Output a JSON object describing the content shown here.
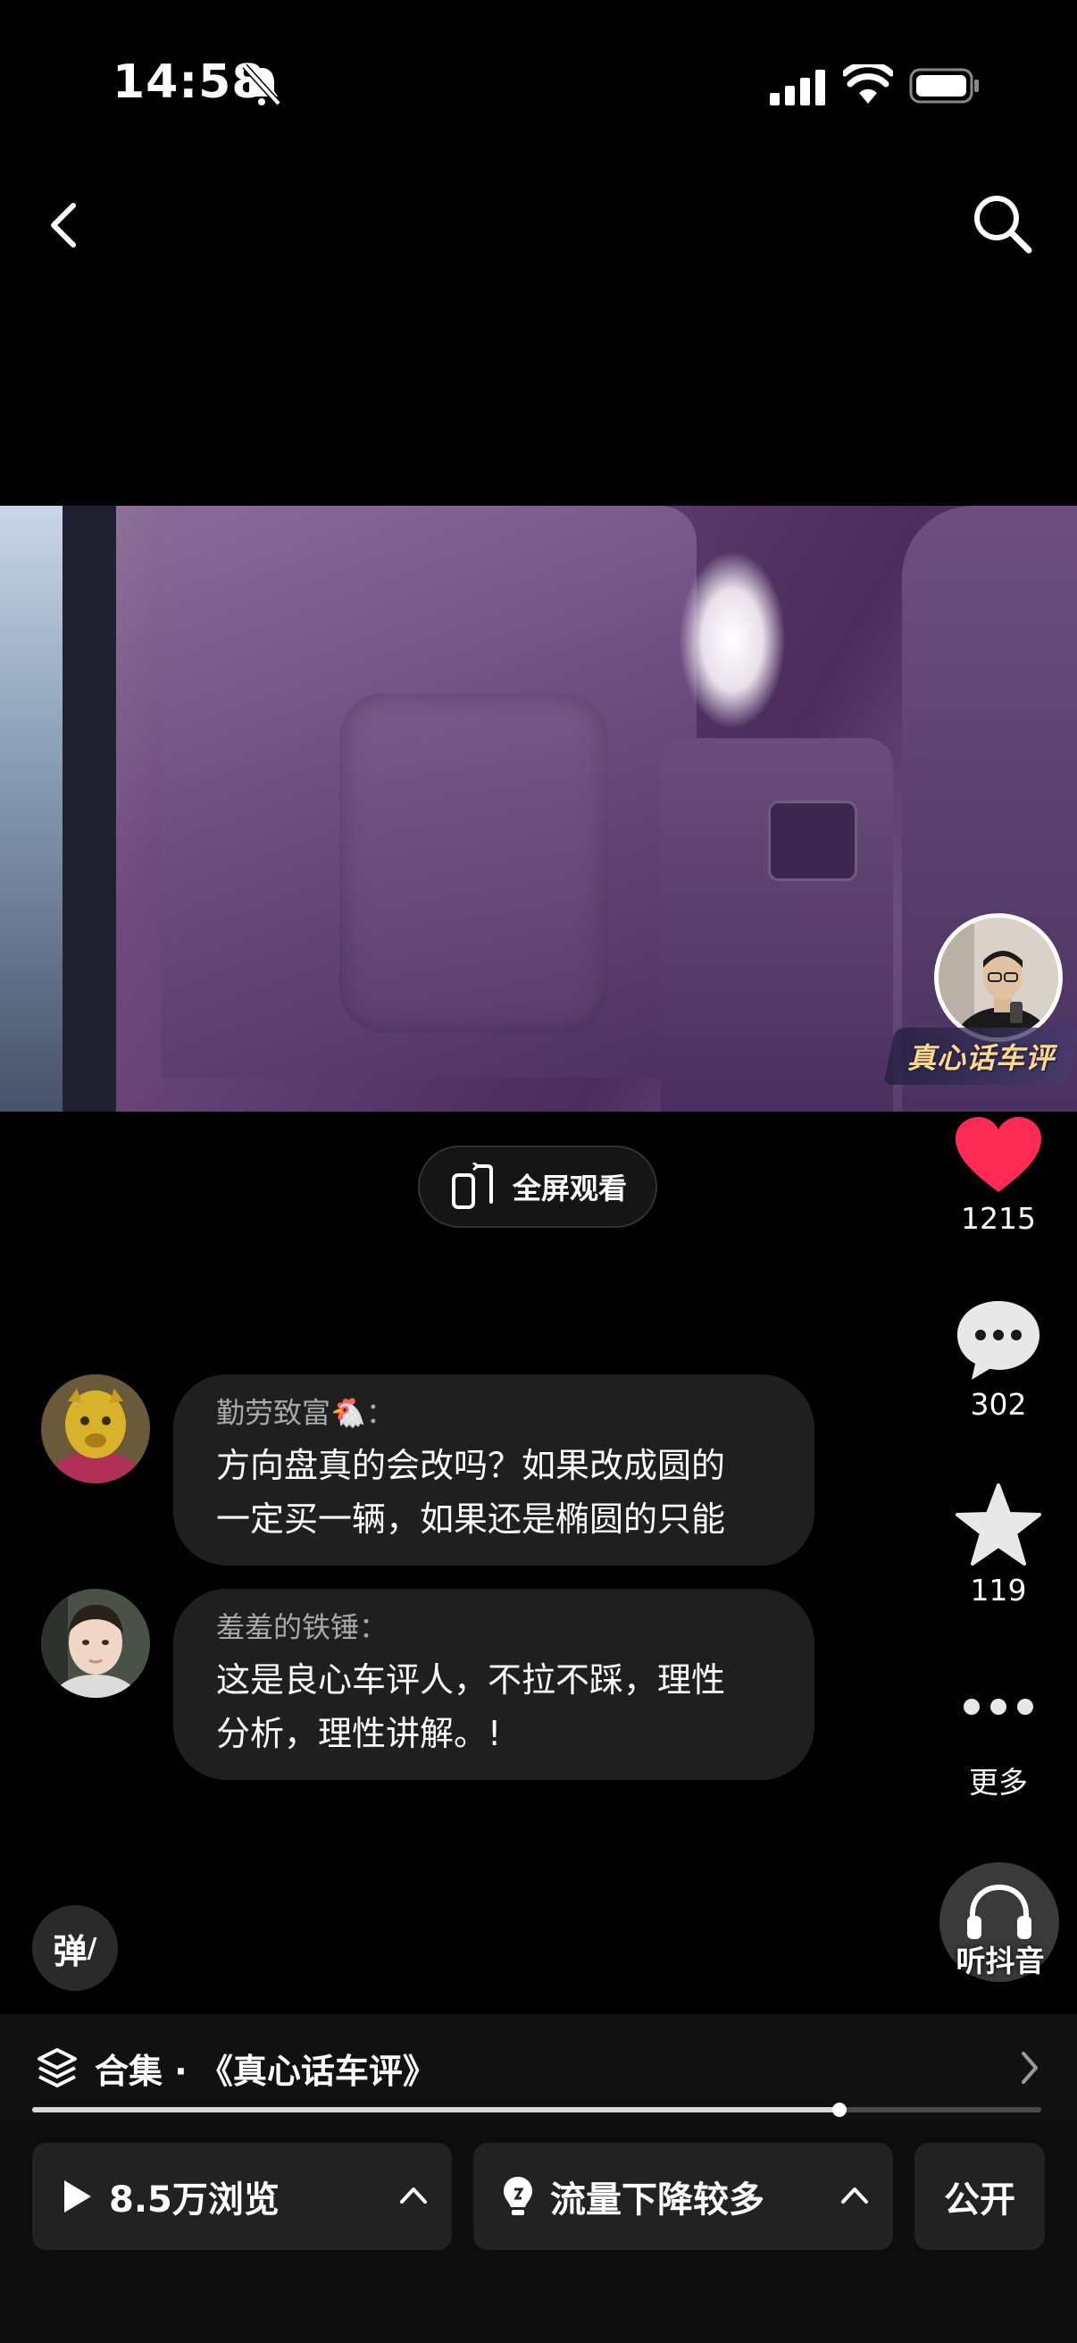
{
  "status_bar": {
    "time": "14:58",
    "icons": [
      "bell-slash-icon",
      "signal-icon",
      "wifi-icon",
      "battery-icon"
    ]
  },
  "nav": {
    "back_icon": "chevron-left-icon",
    "search_icon": "search-icon"
  },
  "video": {
    "watermark": "真心话车评",
    "fullscreen_label": "全屏观看"
  },
  "actions": {
    "like_count": "1215",
    "comment_count": "302",
    "favorite_count": "119",
    "more_label": "更多",
    "listen_label": "听抖音",
    "like_color": "#fe2c55"
  },
  "comments": [
    {
      "name": "勤劳致富🐔：",
      "text_line1": "方向盘真的会改吗？如果改成圆的",
      "text_line2": "一定买一辆，如果还是椭圆的只能"
    },
    {
      "name": "羞羞的铁锤：",
      "text_line1": "这是良心车评人，不拉不踩，理性",
      "text_line2": "分析，理性讲解。!"
    }
  ],
  "danmaku_label": "弹",
  "collection": {
    "label": "合集 · 《真心话车评》"
  },
  "progress": {
    "fraction": 0.8
  },
  "bottom_bar": {
    "views_label": "8.5万浏览",
    "traffic_label": "流量下降较多",
    "public_label": "公开"
  }
}
